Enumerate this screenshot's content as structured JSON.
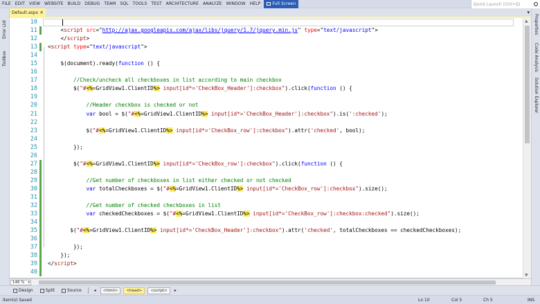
{
  "menu": {
    "items": [
      "FILE",
      "EDIT",
      "VIEW",
      "WEBSITE",
      "BUILD",
      "DEBUG",
      "TEAM",
      "SQL",
      "TOOLS",
      "TEST",
      "ARCHITECTURE",
      "ANALYZE",
      "WINDOW",
      "HELP"
    ],
    "fullscreen_label": "Full Screen",
    "quick_launch_placeholder": "Quick Launch (Ctrl+Q)"
  },
  "left_tabs": [
    "Error List",
    "Toolbox"
  ],
  "right_tabs": [
    "Properties",
    "Code Analysis",
    "Solution Explorer"
  ],
  "document_tab": {
    "name": "Default.aspx",
    "close_glyph": "×"
  },
  "code": {
    "lines": [
      {
        "num": "10",
        "segs": []
      },
      {
        "num": "11",
        "segs": [
          [
            "    ",
            ""
          ],
          [
            "<",
            ""
          ],
          [
            "script",
            "t"
          ],
          [
            " ",
            ""
          ],
          [
            "src",
            "a"
          ],
          [
            "=\"",
            ""
          ],
          [
            "http://ajax.googleapis.com/ajax/libs/jquery/1.7/jquery.min.js",
            "u"
          ],
          [
            "\"",
            ""
          ],
          [
            " ",
            ""
          ],
          [
            "type",
            "a"
          ],
          [
            "=\"",
            ""
          ],
          [
            "text/javascript",
            "k"
          ],
          [
            "\">",
            ""
          ]
        ]
      },
      {
        "num": "12",
        "segs": [
          [
            "    ",
            ""
          ],
          [
            "</",
            ""
          ],
          [
            "script",
            "t"
          ],
          [
            ">",
            ""
          ]
        ]
      },
      {
        "num": "13",
        "segs": [
          [
            "<",
            ""
          ],
          [
            "script",
            "t"
          ],
          [
            " ",
            ""
          ],
          [
            "type",
            "a"
          ],
          [
            "=\"",
            ""
          ],
          [
            "text/javascript",
            "k"
          ],
          [
            "\">",
            ""
          ]
        ]
      },
      {
        "num": "14",
        "segs": []
      },
      {
        "num": "15",
        "segs": [
          [
            "    $(document).ready(",
            ""
          ],
          [
            "function",
            "k"
          ],
          [
            " () {",
            ""
          ]
        ]
      },
      {
        "num": "16",
        "segs": []
      },
      {
        "num": "17",
        "segs": [
          [
            "        //Check/uncheck all checkboxes in list according to main checkbox",
            "c"
          ]
        ]
      },
      {
        "num": "18",
        "segs": [
          [
            "        $(",
            ""
          ],
          [
            "\"#",
            "s"
          ],
          [
            "<%",
            "d"
          ],
          [
            "=GridView1.ClientID",
            ""
          ],
          [
            "%>",
            "d"
          ],
          [
            " input[id*='CheckBox_Header']:checkbox\"",
            "s"
          ],
          [
            ").click(",
            ""
          ],
          [
            "function",
            "k"
          ],
          [
            " () {",
            ""
          ]
        ]
      },
      {
        "num": "19",
        "segs": []
      },
      {
        "num": "20",
        "segs": [
          [
            "            //Header checkbox is checked or not",
            "c"
          ]
        ]
      },
      {
        "num": "21",
        "segs": [
          [
            "            ",
            ""
          ],
          [
            "var",
            "k"
          ],
          [
            " bool = $(",
            ""
          ],
          [
            "\"#",
            "s"
          ],
          [
            "<%",
            "d"
          ],
          [
            "=GridView1.ClientID",
            ""
          ],
          [
            "%>",
            "d"
          ],
          [
            " input[id*='CheckBox_Header']:checkbox\"",
            "s"
          ],
          [
            ").is(",
            ""
          ],
          [
            "':checked'",
            "s"
          ],
          [
            ");",
            ""
          ]
        ]
      },
      {
        "num": "22",
        "segs": []
      },
      {
        "num": "23",
        "segs": [
          [
            "            $(",
            ""
          ],
          [
            "\"#",
            "s"
          ],
          [
            "<%",
            "d"
          ],
          [
            "=GridView1.ClientID",
            ""
          ],
          [
            "%>",
            "d"
          ],
          [
            " input[id*='CheckBox_row']:checkbox\"",
            "s"
          ],
          [
            ").attr(",
            ""
          ],
          [
            "'checked'",
            "s"
          ],
          [
            ", bool);",
            ""
          ]
        ]
      },
      {
        "num": "24",
        "segs": []
      },
      {
        "num": "25",
        "segs": [
          [
            "        });",
            ""
          ]
        ]
      },
      {
        "num": "26",
        "segs": []
      },
      {
        "num": "27",
        "segs": [
          [
            "        $(",
            ""
          ],
          [
            "\"#",
            "s"
          ],
          [
            "<%",
            "d"
          ],
          [
            "=GridView1.ClientID",
            ""
          ],
          [
            "%>",
            "d"
          ],
          [
            " input[id*='CheckBox_row']:checkbox\"",
            "s"
          ],
          [
            ").click(",
            ""
          ],
          [
            "function",
            "k"
          ],
          [
            " () {",
            ""
          ]
        ]
      },
      {
        "num": "28",
        "segs": []
      },
      {
        "num": "29",
        "segs": [
          [
            "            //Get number of checkboxes in list either checked or not checked",
            "c"
          ]
        ]
      },
      {
        "num": "30",
        "segs": [
          [
            "            ",
            ""
          ],
          [
            "var",
            "k"
          ],
          [
            " totalCheckboxes = $(",
            ""
          ],
          [
            "\"#",
            "s"
          ],
          [
            "<%",
            "d"
          ],
          [
            "=GridView1.ClientID",
            ""
          ],
          [
            "%>",
            "d"
          ],
          [
            " input[id*='CheckBox_row']:checkbox\"",
            "s"
          ],
          [
            ").size();",
            ""
          ]
        ]
      },
      {
        "num": "31",
        "segs": []
      },
      {
        "num": "32",
        "segs": [
          [
            "            //Get number of checked checkboxes in list",
            "c"
          ]
        ]
      },
      {
        "num": "33",
        "segs": [
          [
            "            ",
            ""
          ],
          [
            "var",
            "k"
          ],
          [
            " checkedCheckboxes = $(",
            ""
          ],
          [
            "\"#",
            "s"
          ],
          [
            "<%",
            "d"
          ],
          [
            "=GridView1.ClientID",
            ""
          ],
          [
            "%>",
            "d"
          ],
          [
            " input[id*='CheckBox_row']:checkbox:checked\"",
            "s"
          ],
          [
            ").size();",
            ""
          ]
        ]
      },
      {
        "num": "34",
        "segs": []
      },
      {
        "num": "35",
        "segs": [
          [
            "       $(",
            ""
          ],
          [
            "\"#",
            "s"
          ],
          [
            "<%",
            "d"
          ],
          [
            "=GridView1.ClientID",
            ""
          ],
          [
            "%>",
            "d"
          ],
          [
            " input[id*='CheckBox_Header']:checkbox\"",
            "s"
          ],
          [
            ").attr(",
            ""
          ],
          [
            "'checked'",
            "s"
          ],
          [
            ", totalCheckboxes == checkedCheckboxes);",
            ""
          ]
        ]
      },
      {
        "num": "36",
        "segs": []
      },
      {
        "num": "37",
        "segs": [
          [
            "        });",
            ""
          ]
        ]
      },
      {
        "num": "38",
        "segs": [
          [
            "    });",
            ""
          ]
        ]
      },
      {
        "num": "39",
        "segs": [
          [
            "</",
            ""
          ],
          [
            "script",
            "t"
          ],
          [
            ">",
            ""
          ]
        ]
      },
      {
        "num": "40",
        "segs": []
      }
    ],
    "changed_rows": [
      1,
      3,
      17,
      18,
      19,
      20,
      21,
      22,
      23,
      24,
      25,
      26,
      27,
      28,
      29,
      30
    ]
  },
  "zoom": {
    "level": "146 %"
  },
  "views": {
    "design": "Design",
    "split": "Split",
    "source": "Source"
  },
  "breadcrumbs": [
    "<html>",
    "<head>",
    "<script>"
  ],
  "status": {
    "message": "Item(s) Saved",
    "line": "Ln 10",
    "col": "Col 5",
    "ch": "Ch 5",
    "mode": "INS"
  },
  "colors": {
    "accent_tab": "#fff29d",
    "aspx_delimiter_bg": "#ffee62",
    "comment": "#008000",
    "keyword": "#0000ff",
    "string": "#a31515",
    "line_number": "#2b91af"
  }
}
